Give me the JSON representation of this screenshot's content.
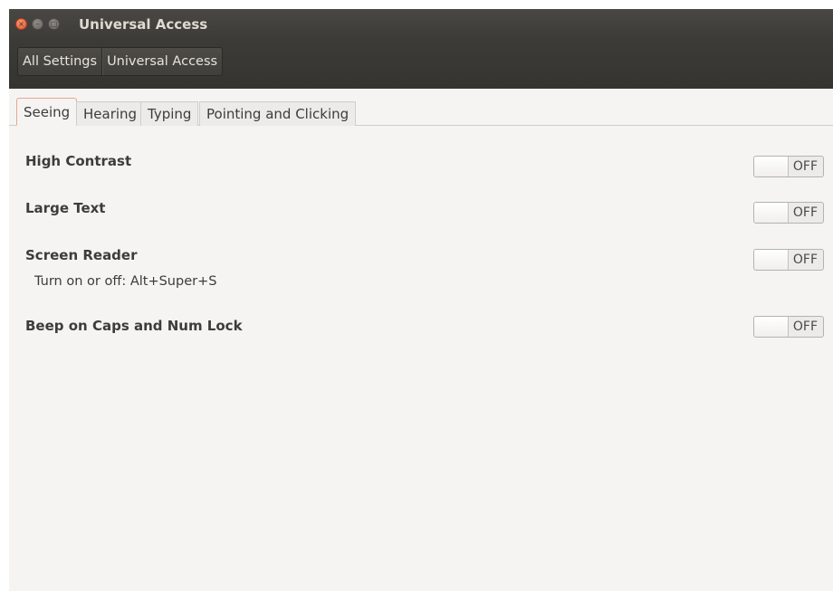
{
  "window": {
    "title": "Universal Access",
    "close_glyph": "×",
    "minimize_glyph": "–",
    "maximize_glyph": "□"
  },
  "breadcrumb": [
    "All Settings",
    "Universal Access"
  ],
  "tabs": [
    {
      "label": "Seeing",
      "active": true
    },
    {
      "label": "Hearing",
      "active": false
    },
    {
      "label": "Typing",
      "active": false
    },
    {
      "label": "Pointing and Clicking",
      "active": false
    }
  ],
  "settings": [
    {
      "label": "High Contrast",
      "state": "OFF"
    },
    {
      "label": "Large Text",
      "state": "OFF"
    },
    {
      "label": "Screen Reader",
      "state": "OFF",
      "sublabel": "Turn on or off:  Alt+Super+S"
    },
    {
      "label": "Beep on Caps and Num Lock",
      "state": "OFF"
    }
  ],
  "colors": {
    "titlebar": "#3c3b37",
    "close_button": "#e0522e",
    "active_tab_border": "#e8a58f",
    "content_background": "#f5f4f3"
  }
}
